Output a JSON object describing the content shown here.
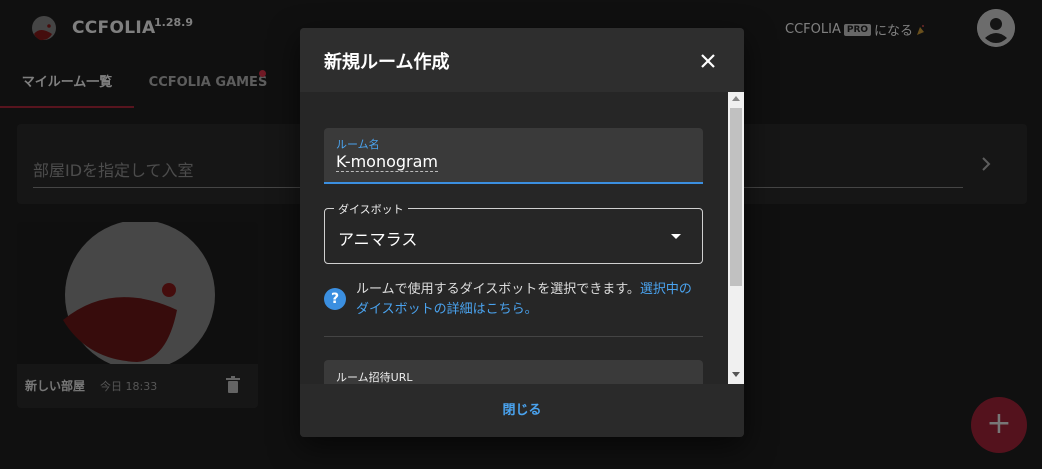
{
  "app": {
    "brand": "CCFOLIA",
    "version": "1.28.9",
    "pro_prefix": "CCFOLIA",
    "pro_badge": "PRO",
    "pro_suffix": "になる",
    "account_icon": "account-circle-icon"
  },
  "tabs": [
    {
      "label": "マイルーム一覧",
      "active": true
    },
    {
      "label": "CCFOLIA GAMES",
      "active": false,
      "has_notification": true
    }
  ],
  "join": {
    "placeholder": "部屋IDを指定して入室",
    "arrow_icon": "chevron-right-icon"
  },
  "room_card": {
    "name": "新しい部屋",
    "time": "今日 18:33",
    "delete_icon": "trash-icon"
  },
  "fab_icon": "plus-icon",
  "dialog": {
    "title": "新規ルーム作成",
    "close_icon": "close-icon",
    "room_name": {
      "label": "ルーム名",
      "value": "K-monogram"
    },
    "dice_bot": {
      "label": "ダイスボット",
      "value": "アニマラス"
    },
    "help": {
      "text": "ルームで使用するダイスボットを選択できます。",
      "link": "選択中のダイスボットの詳細はこちら。"
    },
    "invite_url": {
      "label": "ルーム招待URL"
    },
    "close_label": "閉じる"
  },
  "colors": {
    "accent_red": "#a8243a",
    "accent_blue": "#3b8fe0",
    "background": "#202020",
    "dialog": "#2a2a2a"
  }
}
